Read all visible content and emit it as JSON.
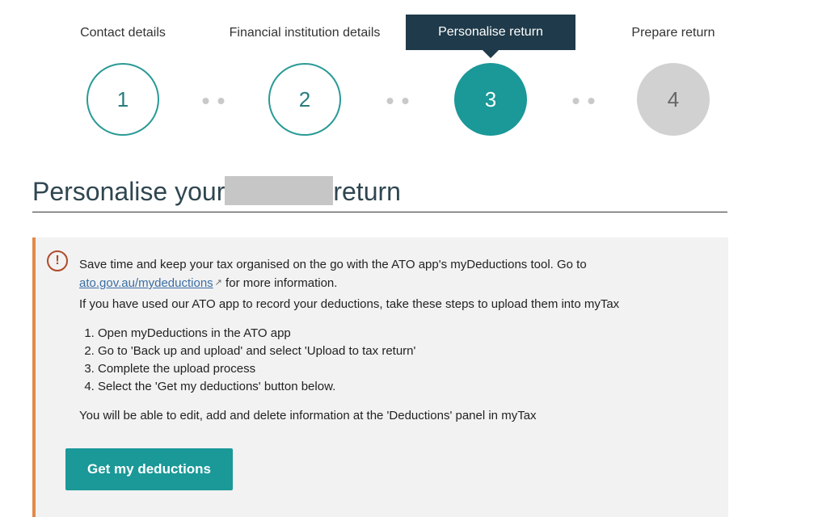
{
  "stepper": {
    "steps": [
      {
        "label": "Contact details",
        "number": "1",
        "state": "done"
      },
      {
        "label": "Financial institution details",
        "number": "2",
        "state": "done"
      },
      {
        "label": "Personalise return",
        "number": "3",
        "state": "current"
      },
      {
        "label": "Prepare return",
        "number": "4",
        "state": "todo"
      }
    ],
    "colors": {
      "active_label_bg": "#1f3a4a",
      "current_circle": "#1b9898",
      "done_border": "#2a9a96",
      "todo_circle": "#d1d1d1"
    }
  },
  "page": {
    "title_before": "Personalise your",
    "title_after": "return"
  },
  "info_panel": {
    "icon": "exclamation-circle-icon",
    "accent_color": "#e08a4a",
    "intro_text": "Save time and keep your tax organised on the go with the ATO app's myDeductions tool. Go to",
    "link_text": "ato.gov.au/mydeductions",
    "link_icon": "external-link-icon",
    "after_link_text": " for more information.",
    "steps_intro": "If you have used our ATO app to record your deductions, take these steps to upload them into myTax",
    "steps": [
      "Open myDeductions in the ATO app",
      "Go to 'Back up and upload' and select 'Upload to tax return'",
      "Complete the upload process",
      "Select the 'Get my deductions' button below."
    ],
    "edit_note": "You will be able to edit, add and delete information at the 'Deductions' panel in myTax",
    "button_label": "Get my deductions",
    "button_color": "#1b9898"
  }
}
